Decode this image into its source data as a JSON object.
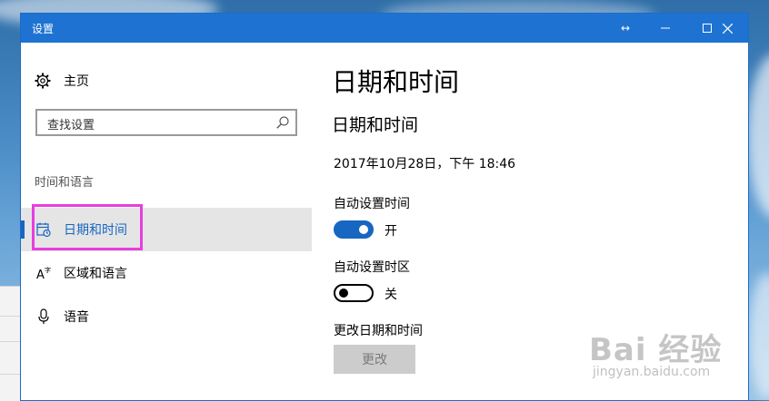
{
  "window": {
    "title": "设置",
    "controls": {
      "resize_icon": "resize-arrows-icon",
      "minimize_icon": "minimize-icon",
      "maximize_icon": "maximize-icon",
      "close_icon": "close-icon"
    }
  },
  "sidebar": {
    "home_label": "主页",
    "search": {
      "placeholder": "查找设置"
    },
    "group_label": "时间和语言",
    "items": [
      {
        "label": "日期和时间",
        "icon": "calendar-clock-icon",
        "selected": true
      },
      {
        "label": "区域和语言",
        "icon": "language-icon",
        "selected": false
      },
      {
        "label": "语音",
        "icon": "microphone-icon",
        "selected": false
      }
    ]
  },
  "main": {
    "page_title": "日期和时间",
    "section_title": "日期和时间",
    "current_datetime": "2017年10月28日，下午 18:46",
    "auto_time": {
      "label": "自动设置时间",
      "state_label": "开",
      "on": true
    },
    "auto_timezone": {
      "label": "自动设置时区",
      "state_label": "关",
      "on": false
    },
    "change_datetime": {
      "label": "更改日期和时间",
      "button_label": "更改"
    }
  },
  "watermark": {
    "main": "Bai 经验",
    "sub": "jingyan.baidu.com"
  },
  "colors": {
    "accent": "#1766c2",
    "titlebar": "#1e73d2",
    "highlight": "#e83ee0"
  }
}
